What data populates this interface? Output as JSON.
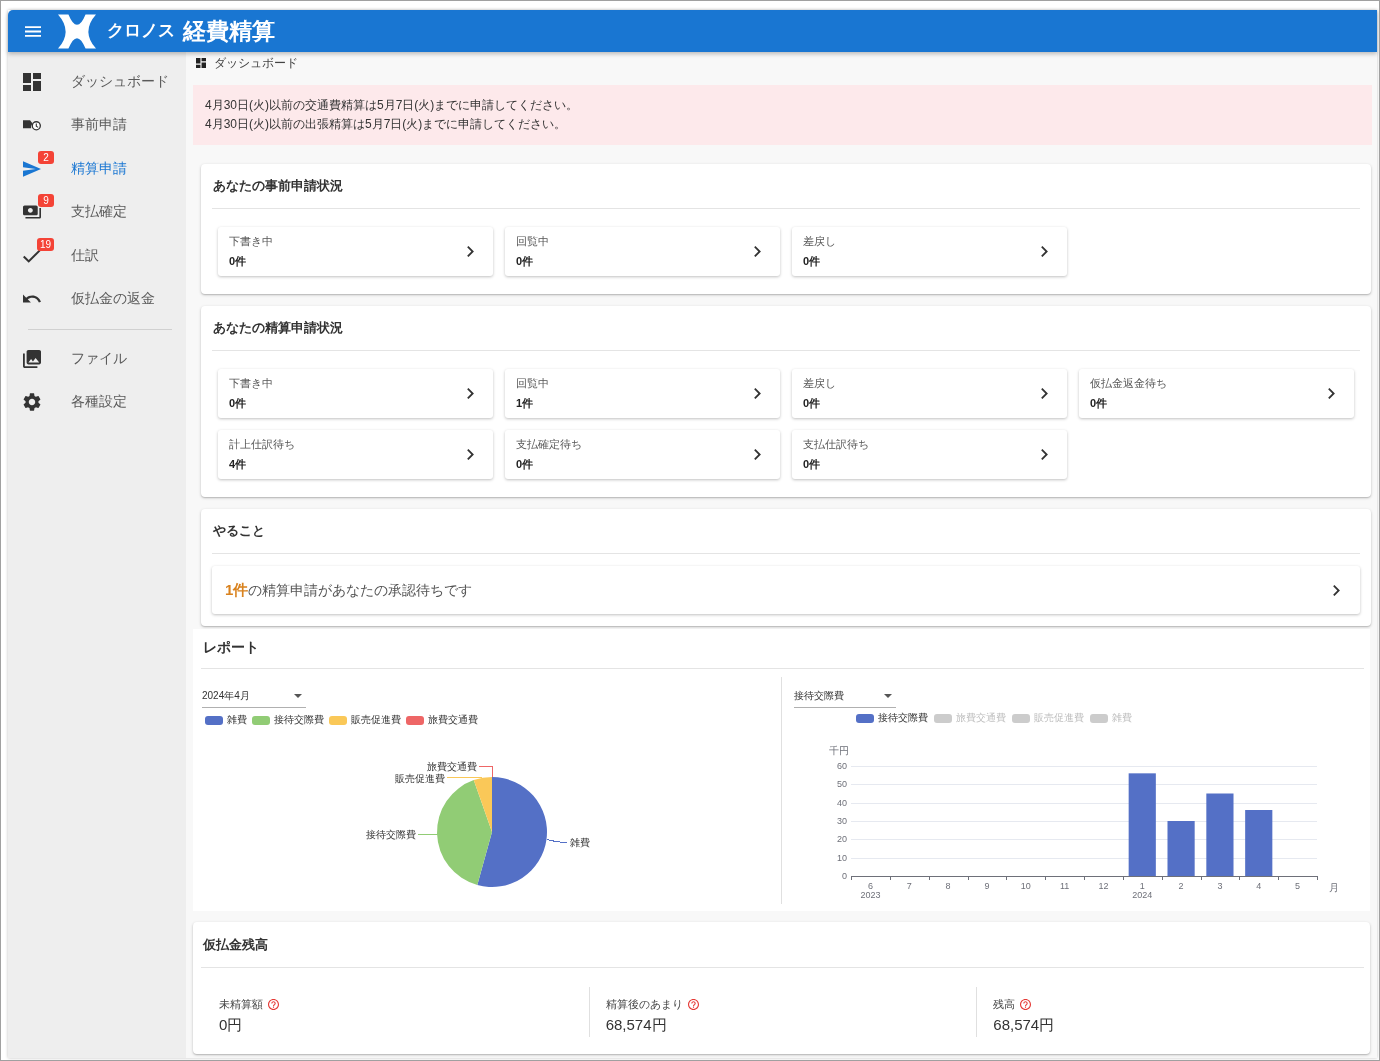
{
  "header": {
    "brand": "クロノス",
    "product": "経費精算"
  },
  "sidebar": {
    "sections": [
      {
        "items": [
          {
            "label": "ダッシュボード",
            "selected": false
          },
          {
            "label": "事前申請",
            "selected": false
          },
          {
            "label": "精算申請",
            "selected": true,
            "badge": "2"
          },
          {
            "label": "支払確定",
            "selected": false,
            "badge": "9"
          },
          {
            "label": "仕訳",
            "selected": false,
            "badge": "19"
          },
          {
            "label": "仮払金の返金",
            "selected": false
          }
        ]
      },
      {
        "items": [
          {
            "label": "ファイル",
            "selected": false
          },
          {
            "label": "各種設定",
            "selected": false
          }
        ]
      }
    ]
  },
  "breadcrumb": "ダッシュボード",
  "notices": [
    "4月30日(火)以前の交通費精算は5月7日(火)までに申請してください。",
    "4月30日(火)以前の出張精算は5月7日(火)までに申請してください。"
  ],
  "status_sections": [
    {
      "title": "あなたの事前申請状況",
      "tiles": [
        {
          "label": "下書き中",
          "count": "0件"
        },
        {
          "label": "回覧中",
          "count": "0件"
        },
        {
          "label": "差戻し",
          "count": "0件"
        }
      ]
    },
    {
      "title": "あなたの精算申請状況",
      "tiles": [
        {
          "label": "下書き中",
          "count": "0件"
        },
        {
          "label": "回覧中",
          "count": "1件"
        },
        {
          "label": "差戻し",
          "count": "0件"
        },
        {
          "label": "仮払金返金待ち",
          "count": "0件"
        },
        {
          "label": "計上仕訳待ち",
          "count": "4件"
        },
        {
          "label": "支払確定待ち",
          "count": "0件"
        },
        {
          "label": "支払仕訳待ち",
          "count": "0件"
        }
      ]
    }
  ],
  "todo": {
    "title": "やること",
    "items": [
      "**1件**の精算申請があなたの承認待ちです"
    ]
  },
  "report": {
    "title": "レポート",
    "left": {
      "month": "2024年4月",
      "legend": [
        {
          "label": "雑費",
          "color": "#5470c6",
          "hidden": false
        },
        {
          "label": "接待交際費",
          "color": "#91cc75",
          "hidden": false
        },
        {
          "label": "販売促進費",
          "color": "#fac858",
          "hidden": false
        },
        {
          "label": "旅費交通費",
          "color": "#ee6666",
          "hidden": false
        }
      ],
      "pie": {
        "slices": [
          {
            "label": "雑費",
            "color": "#5470c6"
          },
          {
            "label": "接待交際費",
            "color": "#91cc75"
          },
          {
            "label": "販売促進費",
            "color": "#fac858"
          },
          {
            "label": "旅費交通費",
            "color": "#ee6666"
          }
        ]
      }
    },
    "right": {
      "category": "接待交際費",
      "legend": [
        {
          "label": "接待交際費",
          "color": "#5470c6",
          "hidden": false
        },
        {
          "label": "旅費交通費",
          "hidden": true
        },
        {
          "label": "販売促進費",
          "hidden": true
        },
        {
          "label": "雑費",
          "hidden": true
        }
      ],
      "chart_data": {
        "type": "bar",
        "xlabel": "月",
        "ylabel": "千円",
        "categories": [
          "6\n2023",
          "7",
          "8",
          "9",
          "10",
          "11",
          "12",
          "1\n2024",
          "2",
          "3",
          "4",
          "5"
        ],
        "series": [
          {
            "color": "#5470c6",
            "values": [
              null,
              null,
              null,
              null,
              null,
              null,
              null,
              56,
              30,
              45,
              36,
              null
            ]
          }
        ],
        "ylim": [
          0,
          60
        ],
        "yticks": [
          0,
          10,
          20,
          30,
          40,
          50,
          60
        ],
        "grid": true
      }
    }
  },
  "balance": {
    "title": "仮払金残高",
    "items": [
      {
        "label": "未精算額",
        "value": "0円"
      },
      {
        "label": "精算後のあまり",
        "value": "68,574円"
      },
      {
        "label": "残高",
        "value": "68,574円"
      }
    ]
  }
}
